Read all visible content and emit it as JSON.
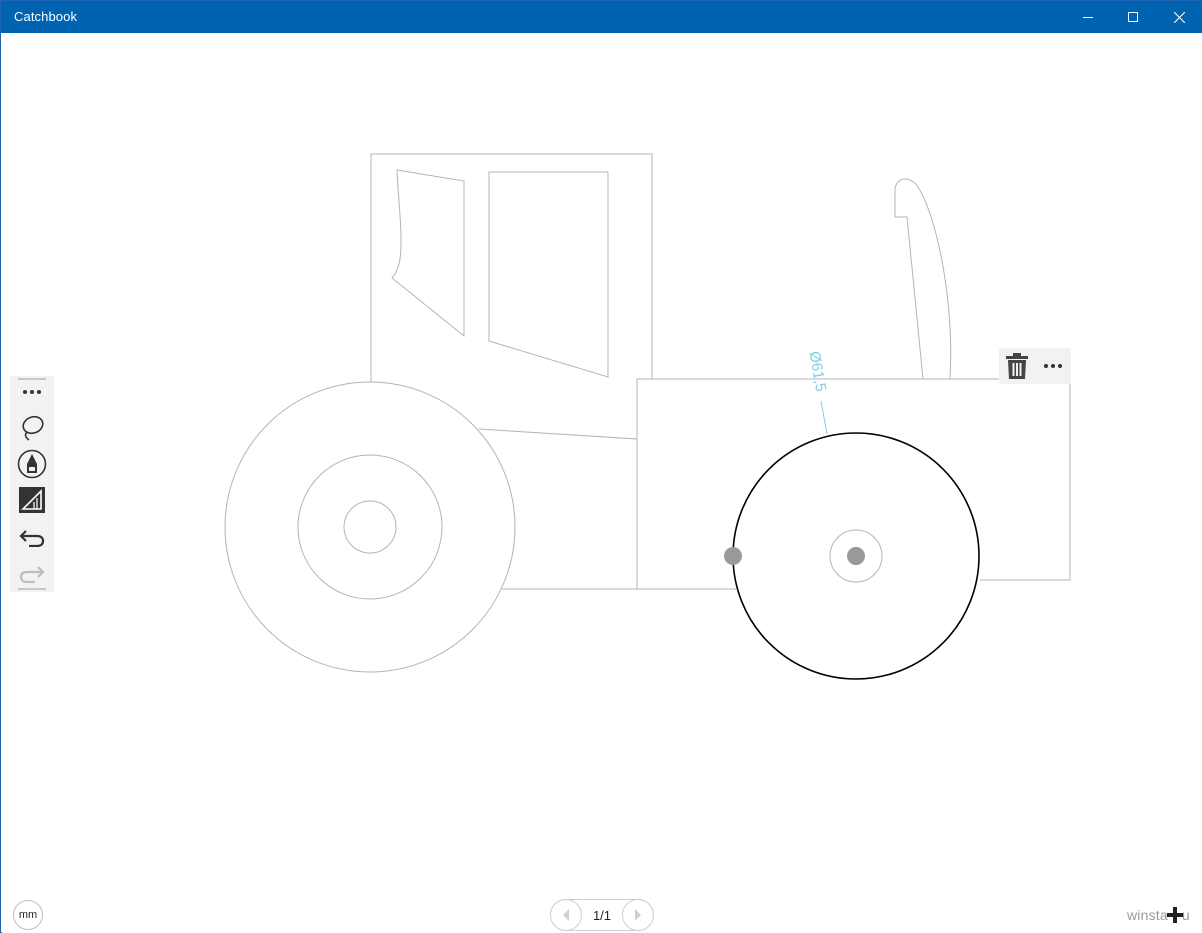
{
  "window": {
    "title": "Catchbook",
    "accent_color": "#0063b1",
    "controls": [
      {
        "name": "minimize",
        "icon": "minimize-icon"
      },
      {
        "name": "maximize",
        "icon": "maximize-icon"
      },
      {
        "name": "close",
        "icon": "close-icon"
      }
    ]
  },
  "toolbar": {
    "tools": [
      {
        "name": "more",
        "icon": "more-icon"
      },
      {
        "name": "lasso",
        "icon": "lasso-icon"
      },
      {
        "name": "pen",
        "icon": "pen-icon",
        "selected": true
      },
      {
        "name": "ruler",
        "icon": "ruler-icon"
      },
      {
        "name": "undo",
        "icon": "undo-icon"
      },
      {
        "name": "redo",
        "icon": "redo-icon",
        "disabled": true
      }
    ]
  },
  "selection": {
    "dimension_label": "Ø61,5",
    "dimension_color": "#7fd0e6",
    "actions": [
      {
        "name": "delete",
        "icon": "trash-icon"
      },
      {
        "name": "more",
        "icon": "more-icon"
      }
    ]
  },
  "footer": {
    "unit": "mm",
    "page_indicator": "1/1",
    "watermark": "winsta",
    "watermark_tail": "u"
  },
  "drawing": {
    "stroke_color": "#b4b4b4",
    "selected_stroke_color": "#000000",
    "handle_color": "#999999"
  }
}
